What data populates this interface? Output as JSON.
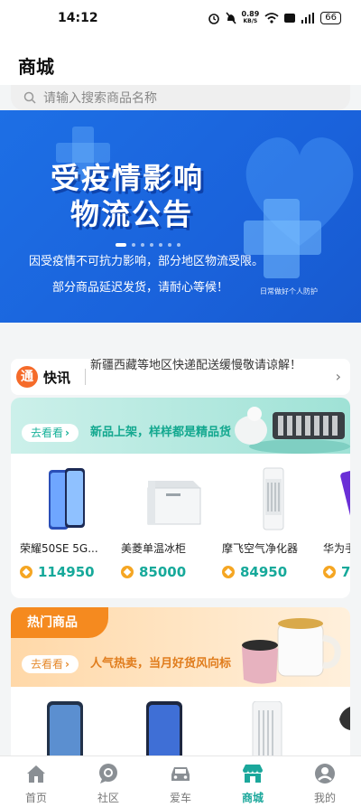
{
  "statusbar": {
    "time": "14:12",
    "speed_value": "0.89",
    "speed_unit": "KB/S",
    "battery": "66"
  },
  "header": {
    "title": "商城"
  },
  "search": {
    "placeholder": "请输入搜索商品名称"
  },
  "banner": {
    "title_line1": "受疫情影响",
    "title_line2": "物流公告",
    "text_line1": "因受疫情不可抗力影响，部分地区物流受限。",
    "text_line2": "部分商品延迟发货，请耐心等候！",
    "tag": "日常做好个人防护",
    "slide_count": 7,
    "active_slide": 1
  },
  "news": {
    "badge": "通",
    "label": "快讯",
    "text": "新疆西藏等地区快递配送缓慢敬请谅解！"
  },
  "new_products": {
    "button": "去看看",
    "slogan": "新品上架，样样都是精品货",
    "items": [
      {
        "name": "荣耀50SE 5G...",
        "price": "114950",
        "icon": "smartphone-icon"
      },
      {
        "name": "美菱单温冰柜",
        "price": "85000",
        "icon": "chest-freezer-icon"
      },
      {
        "name": "摩飞空气净化器",
        "price": "84950",
        "icon": "air-purifier-icon"
      },
      {
        "name": "华为手",
        "price": "7",
        "icon": "smartphone-icon"
      }
    ]
  },
  "hot_products": {
    "tab": "热门商品",
    "button": "去看看",
    "slogan": "人气热卖，当月好货风向标"
  },
  "tabbar": {
    "items": [
      {
        "label": "首页",
        "icon": "home-icon"
      },
      {
        "label": "社区",
        "icon": "chat-bubble-icon"
      },
      {
        "label": "爱车",
        "icon": "car-icon"
      },
      {
        "label": "商城",
        "icon": "store-icon",
        "active": true
      },
      {
        "label": "我的",
        "icon": "user-icon"
      }
    ]
  },
  "colors": {
    "accent": "#1ba79b",
    "banner_blue": "#1a62db",
    "hot_orange": "#f58a1f",
    "coin": "#f5a623"
  }
}
